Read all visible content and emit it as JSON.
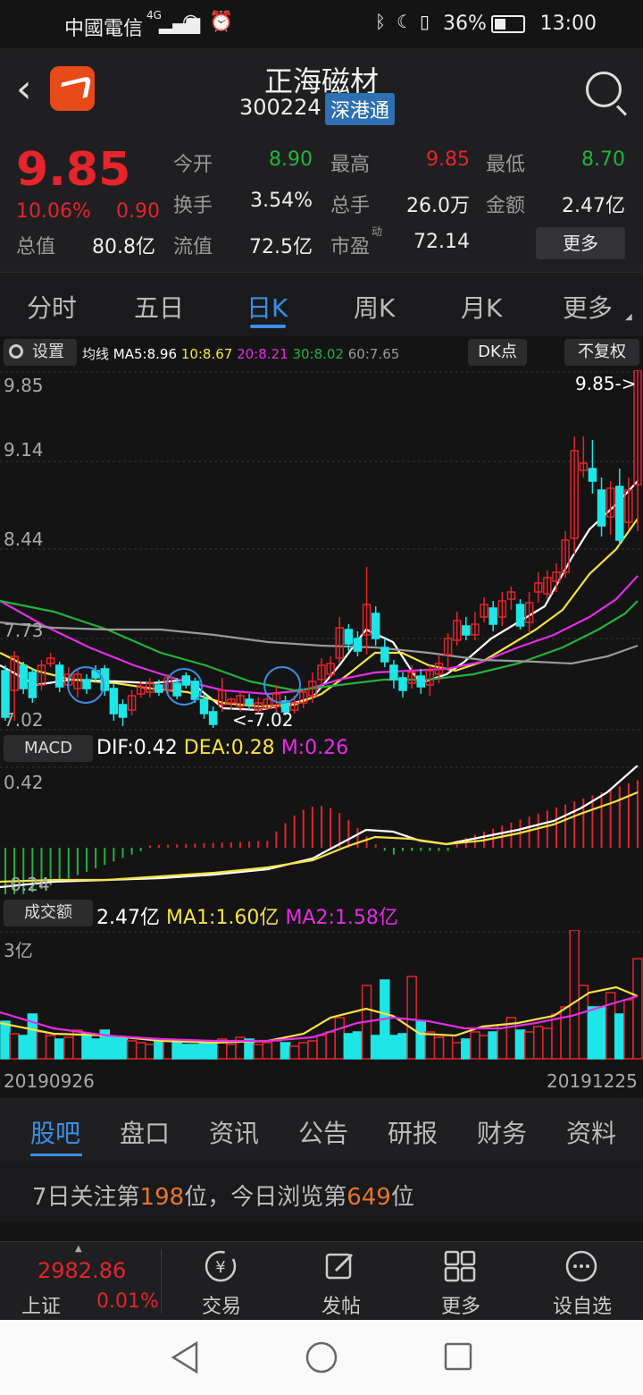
{
  "status_bar": {
    "carrier": "中國電信",
    "network": "4G",
    "battery": "36%",
    "time": "13:00"
  },
  "header": {
    "title": "正海磁材",
    "code": "300224",
    "badge": "深港通"
  },
  "quote": {
    "price": "9.85",
    "change_pct": "10.06%",
    "change_amt": "0.90",
    "fields": [
      {
        "label": "今开",
        "value": "8.90",
        "color": "green"
      },
      {
        "label": "最高",
        "value": "9.85",
        "color": "red"
      },
      {
        "label": "最低",
        "value": "8.70",
        "color": "green"
      },
      {
        "label": "换手",
        "value": "3.54%",
        "color": ""
      },
      {
        "label": "总手",
        "value": "26.0万",
        "color": ""
      },
      {
        "label": "金额",
        "value": "2.47亿",
        "color": ""
      },
      {
        "label": "总值",
        "value": "80.8亿",
        "color": ""
      },
      {
        "label": "流值",
        "value": "72.5亿",
        "color": ""
      },
      {
        "label": "市盈",
        "label_sup": "动",
        "value": "72.14",
        "color": ""
      }
    ],
    "more_label": "更多"
  },
  "ktabs": [
    "分时",
    "五日",
    "日K",
    "周K",
    "月K",
    "更多"
  ],
  "toolbar": {
    "settings_label": "设置",
    "ma_label": "均线",
    "ma5": "MA5:8.96",
    "ma10": "10:8.67",
    "ma20": "20:8.21",
    "ma30": "30:8.02",
    "ma60": "60:7.65",
    "dk_label": "DK点",
    "adjust_label": "不复权"
  },
  "colors": {
    "up": "#e5242c",
    "down": "#1ee6e6",
    "ma5": "#ffffff",
    "ma10": "#f5e342",
    "ma20": "#e62ce6",
    "ma30": "#23b33c",
    "ma60": "#9a9a9a",
    "accent": "#3a8ee6"
  },
  "chart_data": {
    "type": "candlestick",
    "y_ticks": [
      "9.85",
      "9.14",
      "8.44",
      "7.73",
      "7.02"
    ],
    "max_label": "9.85->",
    "min_label": "<-7.02",
    "ylim": [
      7.02,
      9.85
    ],
    "x_start": "20190926",
    "x_end": "20191225",
    "macd": {
      "label": "MACD",
      "dif": "DIF:0.42",
      "dea": "DEA:0.28",
      "m": "M:0.26",
      "y_ticks": [
        "0.42",
        "-0.24"
      ]
    },
    "volume": {
      "label": "成交额",
      "value": "2.47亿",
      "ma1": "MA1:1.60亿",
      "ma2": "MA2:1.58亿",
      "y_tick": "3亿"
    }
  },
  "bottom_tabs": [
    "股吧",
    "盘口",
    "资讯",
    "公告",
    "研报",
    "财务",
    "资料"
  ],
  "attention": {
    "p1": "7日关注第",
    "rank1": "198",
    "p2": "位，今日浏览第",
    "rank2": "649",
    "p3": "位"
  },
  "bottom_bar": {
    "index_value": "2982.86",
    "index_name": "上证",
    "index_change": "0.01%",
    "items": [
      {
        "label": "交易",
        "icon": "yen-icon"
      },
      {
        "label": "发帖",
        "icon": "edit-icon"
      },
      {
        "label": "更多",
        "icon": "grid-icon"
      },
      {
        "label": "设自选",
        "icon": "dots-circle-icon"
      }
    ]
  }
}
